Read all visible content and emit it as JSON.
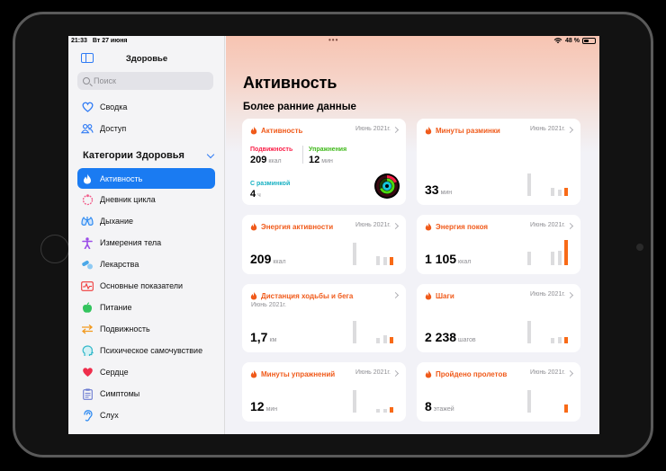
{
  "status": {
    "time": "21:33",
    "date": "Вт 27 июня",
    "dots": "•••",
    "battery": "48 %"
  },
  "sidebar": {
    "title": "Здоровье",
    "search_placeholder": "Поиск",
    "top_items": [
      {
        "label": "Сводка",
        "icon": "heart-outline-icon"
      },
      {
        "label": "Доступ",
        "icon": "people-icon"
      }
    ],
    "categories_header": "Категории Здоровья",
    "categories": [
      {
        "label": "Активность",
        "icon": "flame-icon",
        "color": "#ffffff",
        "active": true
      },
      {
        "label": "Дневник цикла",
        "icon": "cycle-icon",
        "color": "#f25c8a"
      },
      {
        "label": "Дыхание",
        "icon": "lungs-icon",
        "color": "#2f8bf2"
      },
      {
        "label": "Измерения тела",
        "icon": "body-figure-icon",
        "color": "#9b4ce8"
      },
      {
        "label": "Лекарства",
        "icon": "pills-icon",
        "color": "#4aa7e8"
      },
      {
        "label": "Основные показатели",
        "icon": "vitals-icon",
        "color": "#ef3b3b"
      },
      {
        "label": "Питание",
        "icon": "apple-icon",
        "color": "#33c45e"
      },
      {
        "label": "Подвижность",
        "icon": "mobility-arrows-icon",
        "color": "#f29a1f"
      },
      {
        "label": "Психическое самочувствие",
        "icon": "head-icon",
        "color": "#30b8c9"
      },
      {
        "label": "Сердце",
        "icon": "heart-icon",
        "color": "#ef2e4c"
      },
      {
        "label": "Симптомы",
        "icon": "clipboard-icon",
        "color": "#6b7bd1"
      },
      {
        "label": "Слух",
        "icon": "ear-icon",
        "color": "#2f8bf2"
      }
    ]
  },
  "main": {
    "title": "Активность",
    "section_title": "Более ранние данные",
    "activity_card": {
      "title": "Активность",
      "date": "Июнь 2021г.",
      "move_label": "Подвижность",
      "move_value": "209",
      "move_unit": "ккал",
      "exercise_label": "Упражнения",
      "exercise_value": "12",
      "exercise_unit": "мин",
      "stand_label": "С разминкой",
      "stand_value": "4",
      "stand_unit": "ч",
      "move_color": "#fa1f48",
      "exercise_color": "#4cd911",
      "stand_color": "#16c6d8"
    },
    "cards": [
      {
        "title": "Минуты разминки",
        "date": "Июнь 2021г.",
        "value": "33",
        "unit": "мин",
        "bars": [
          0.85,
          0.3,
          0.25,
          0.3
        ]
      },
      {
        "title": "Энергия активности",
        "date": "Июнь 2021г.",
        "value": "209",
        "unit": "ккал",
        "bars": [
          0.85,
          0.35,
          0.3,
          0.3
        ]
      },
      {
        "title": "Энергия покоя",
        "date": "Июнь 2021г.",
        "value": "1 105",
        "unit": "ккал",
        "bars": [
          0.5,
          0.5,
          0.55,
          0.95
        ]
      },
      {
        "title": "Дистанция ходьбы и бега",
        "date": "Июнь 2021г.",
        "value": "1,7",
        "unit": "км",
        "bars": [
          0.85,
          0.2,
          0.3,
          0.25
        ]
      },
      {
        "title": "Шаги",
        "date": "Июнь 2021г.",
        "value": "2 238",
        "unit": "шагов",
        "bars": [
          0.85,
          0.2,
          0.25,
          0.25
        ]
      },
      {
        "title": "Минуты упражнений",
        "date": "Июнь 2021г.",
        "value": "12",
        "unit": "мин",
        "bars": [
          0.85,
          0.15,
          0.15,
          0.2
        ]
      },
      {
        "title": "Пройдено пролетов",
        "date": "Июнь 2021г.",
        "value": "8",
        "unit": "этажей",
        "bars": [
          0.85,
          0.0,
          0.0,
          0.3
        ]
      }
    ]
  },
  "accent_color": "#f05a1a"
}
